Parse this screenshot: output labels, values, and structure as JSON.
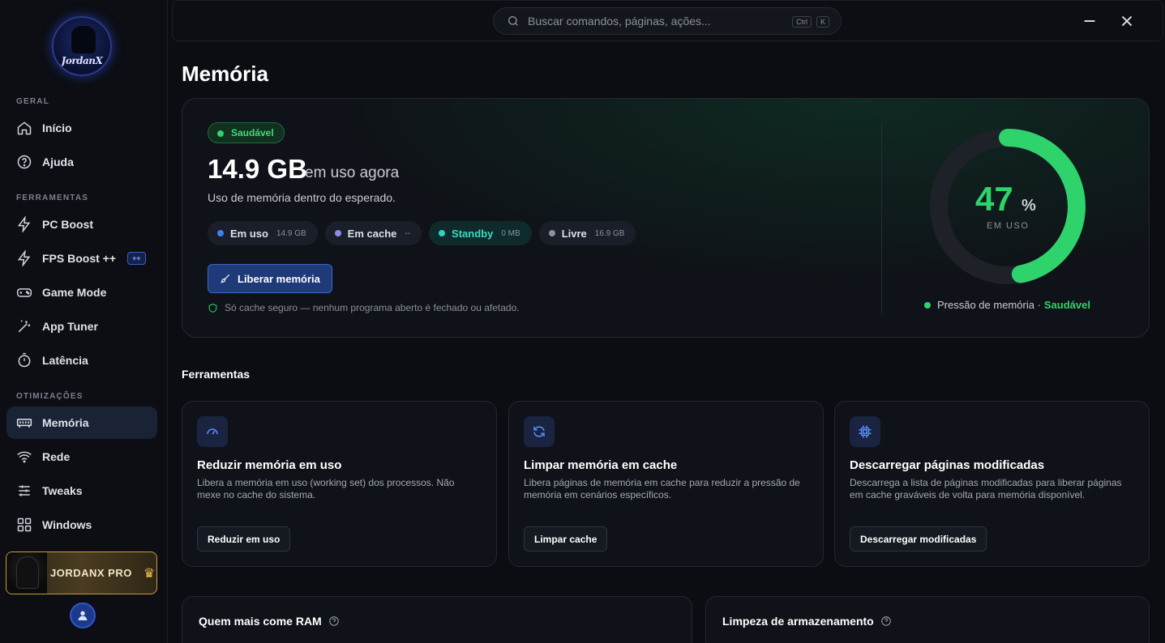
{
  "sidebar": {
    "logo_text": "JordanX",
    "sections": {
      "geral": "GERAL",
      "ferramentas": "FERRAMENTAS",
      "otimizacoes": "OTIMIZAÇÕES"
    },
    "items": [
      {
        "label": "Início",
        "icon": "home-icon"
      },
      {
        "label": "Ajuda",
        "icon": "help-icon"
      },
      {
        "label": "PC Boost",
        "icon": "bolt-icon"
      },
      {
        "label": "FPS Boost ++",
        "icon": "bolt-icon",
        "badge": "++"
      },
      {
        "label": "Game Mode",
        "icon": "gamepad-icon"
      },
      {
        "label": "App Tuner",
        "icon": "magic-wand-icon"
      },
      {
        "label": "Latência",
        "icon": "timer-icon"
      },
      {
        "label": "Memória",
        "icon": "memory-icon",
        "active": true
      },
      {
        "label": "Rede",
        "icon": "wifi-icon"
      },
      {
        "label": "Tweaks",
        "icon": "sliders-icon"
      },
      {
        "label": "Windows",
        "icon": "windows-grid-icon"
      }
    ],
    "pro_label": "JORDANX PRO"
  },
  "topbar": {
    "search_placeholder": "Buscar comandos, páginas, ações...",
    "shortcut_ctrl": "Ctrl",
    "shortcut_k": "K"
  },
  "page": {
    "title": "Memória"
  },
  "hero": {
    "status": "Saudável",
    "value": "14.9 GB",
    "value_suffix": "em uso agora",
    "description": "Uso de memória dentro do esperado.",
    "chips": [
      {
        "label": "Em uso",
        "value": "14.9 GB",
        "color": "#3b82f6"
      },
      {
        "label": "Em cache",
        "value": "--",
        "color": "#8b8cf0"
      },
      {
        "label": "Standby",
        "value": "0 MB",
        "color": "#2dd4bf"
      },
      {
        "label": "Livre",
        "value": "16.9 GB",
        "color": "#8b909c"
      }
    ],
    "free_button": "Liberar memória",
    "safe_note": "Só cache seguro — nenhum programa aberto é fechado ou afetado.",
    "gauge_value": "47",
    "gauge_percent": 47,
    "gauge_unit": "%",
    "gauge_label": "EM USO",
    "pressure_label": "Pressão de memória ·",
    "pressure_value": "Saudável",
    "accent_green": "#2ed36c"
  },
  "tools": {
    "section_title": "Ferramentas",
    "cards": [
      {
        "icon": "speedometer-icon",
        "title": "Reduzir memória em uso",
        "description": "Libera a memória em uso (working set) dos processos. Não mexe no cache do sistema.",
        "button": "Reduzir em uso"
      },
      {
        "icon": "refresh-icon",
        "title": "Limpar memória em cache",
        "description": "Libera páginas de memória em cache para reduzir a pressão de memória em cenários específicos.",
        "button": "Limpar cache"
      },
      {
        "icon": "chip-icon",
        "title": "Descarregar páginas modificadas",
        "description": "Descarrega a lista de páginas modificadas para liberar páginas em cache graváveis de volta para memória disponível.",
        "button": "Descarregar modificadas"
      }
    ]
  },
  "bottom": {
    "ram_title": "Quem mais come RAM",
    "storage_title": "Limpeza de armazenamento"
  }
}
